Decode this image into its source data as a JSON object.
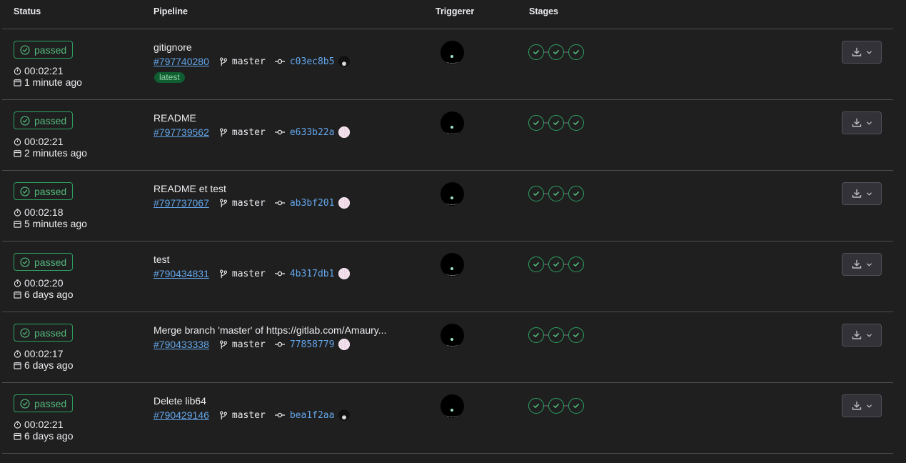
{
  "headers": {
    "status": "Status",
    "pipeline": "Pipeline",
    "triggerer": "Triggerer",
    "stages": "Stages"
  },
  "colors": {
    "success": "#52b87a",
    "link": "#63a6e9",
    "border": "#4c4c52",
    "badge_bg": "#0f5d30"
  },
  "pipelines": [
    {
      "status": "passed",
      "duration": "00:02:21",
      "finished": "1 minute ago",
      "title": "gitignore",
      "id": "#797740280",
      "branch": "master",
      "sha": "c03ec8b5",
      "latest": "latest",
      "commit_avatar": "dark"
    },
    {
      "status": "passed",
      "duration": "00:02:21",
      "finished": "2 minutes ago",
      "title": "README",
      "id": "#797739562",
      "branch": "master",
      "sha": "e633b22a",
      "commit_avatar": "light"
    },
    {
      "status": "passed",
      "duration": "00:02:18",
      "finished": "5 minutes ago",
      "title": "README et test",
      "id": "#797737067",
      "branch": "master",
      "sha": "ab3bf201",
      "commit_avatar": "light"
    },
    {
      "status": "passed",
      "duration": "00:02:20",
      "finished": "6 days ago",
      "title": "test",
      "id": "#790434831",
      "branch": "master",
      "sha": "4b317db1",
      "commit_avatar": "light"
    },
    {
      "status": "passed",
      "duration": "00:02:17",
      "finished": "6 days ago",
      "title": "Merge branch 'master' of https://gitlab.com/Amaury...",
      "id": "#790433338",
      "branch": "master",
      "sha": "77858779",
      "commit_avatar": "light"
    },
    {
      "status": "passed",
      "duration": "00:02:21",
      "finished": "6 days ago",
      "title": "Delete lib64",
      "id": "#790429146",
      "branch": "master",
      "sha": "bea1f2aa",
      "commit_avatar": "dark"
    }
  ]
}
